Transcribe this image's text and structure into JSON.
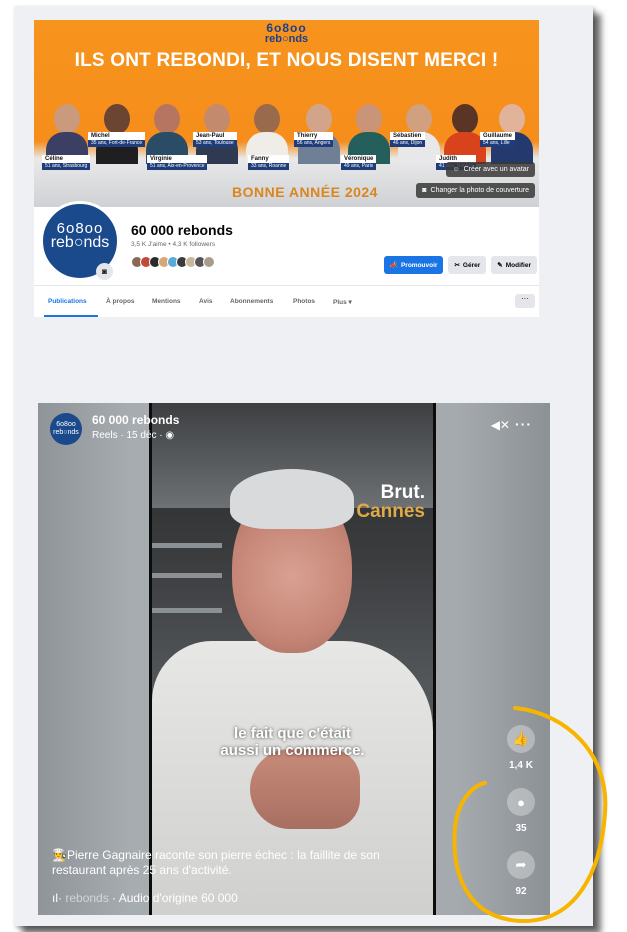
{
  "cover": {
    "logo_top": "6o8oo",
    "logo_bottom": "reb○nds",
    "title": "ILS ONT REBONDI, ET NOUS DISENT MERCI !",
    "year_text": "BONNE ANNÉE 2024",
    "avatar_button": "Créer avec un avatar",
    "cover_button": "Changer la photo de couverture",
    "people_top": [
      {
        "name": "Michel",
        "detail": "35 ans, Fort-de-France"
      },
      {
        "name": "Jean-Paul",
        "detail": "53 ans, Toulouse"
      },
      {
        "name": "Thierry",
        "detail": "56 ans, Angers"
      },
      {
        "name": "Sébastien",
        "detail": "46 ans, Dijon"
      },
      {
        "name": "Guillaume",
        "detail": "54 ans, Lille"
      }
    ],
    "people_bottom": [
      {
        "name": "Céline",
        "detail": "51 ans, Strasbourg"
      },
      {
        "name": "Virginie",
        "detail": "51 ans, Aix-en-Provence"
      },
      {
        "name": "Fanny",
        "detail": "33 ans, Roanne"
      },
      {
        "name": "Véronique",
        "detail": "49 ans, Paris"
      },
      {
        "name": "Judith",
        "detail": "41 ans, Nantes"
      }
    ]
  },
  "profile": {
    "avatar_line1": "6o8oo",
    "avatar_line2": "reb○nds",
    "name": "60 000 rebonds",
    "stats": "3,5 K J'aime • 4,3 K followers",
    "buttons": {
      "promote": "Promouvoir",
      "manage": "Gérer",
      "edit": "Modifier"
    }
  },
  "tabs": [
    "Publications",
    "À propos",
    "Mentions",
    "Avis",
    "Abonnements",
    "Photos",
    "Plus ▾"
  ],
  "reel": {
    "page_name": "60 000 rebonds",
    "meta": "Reels · 15 déc ·",
    "brut_line1": "Brut.",
    "brut_line2": "Cannes",
    "subtitle_line1": "le fait que c'était",
    "subtitle_line2": "aussi un commerce.",
    "likes": "1,4 K",
    "comments": "35",
    "shares": "92",
    "caption": "👨‍🍳Pierre Gagnaire raconte son pierre échec : la faillite de son restaurant après 25 ans d'activité.",
    "audio_prefix": "rebonds",
    "audio_main": " · Audio d'origine      60 000",
    "colors": {
      "annotation": "#f7b500",
      "accent": "#1b74e4",
      "cover": "#f7941d"
    }
  }
}
